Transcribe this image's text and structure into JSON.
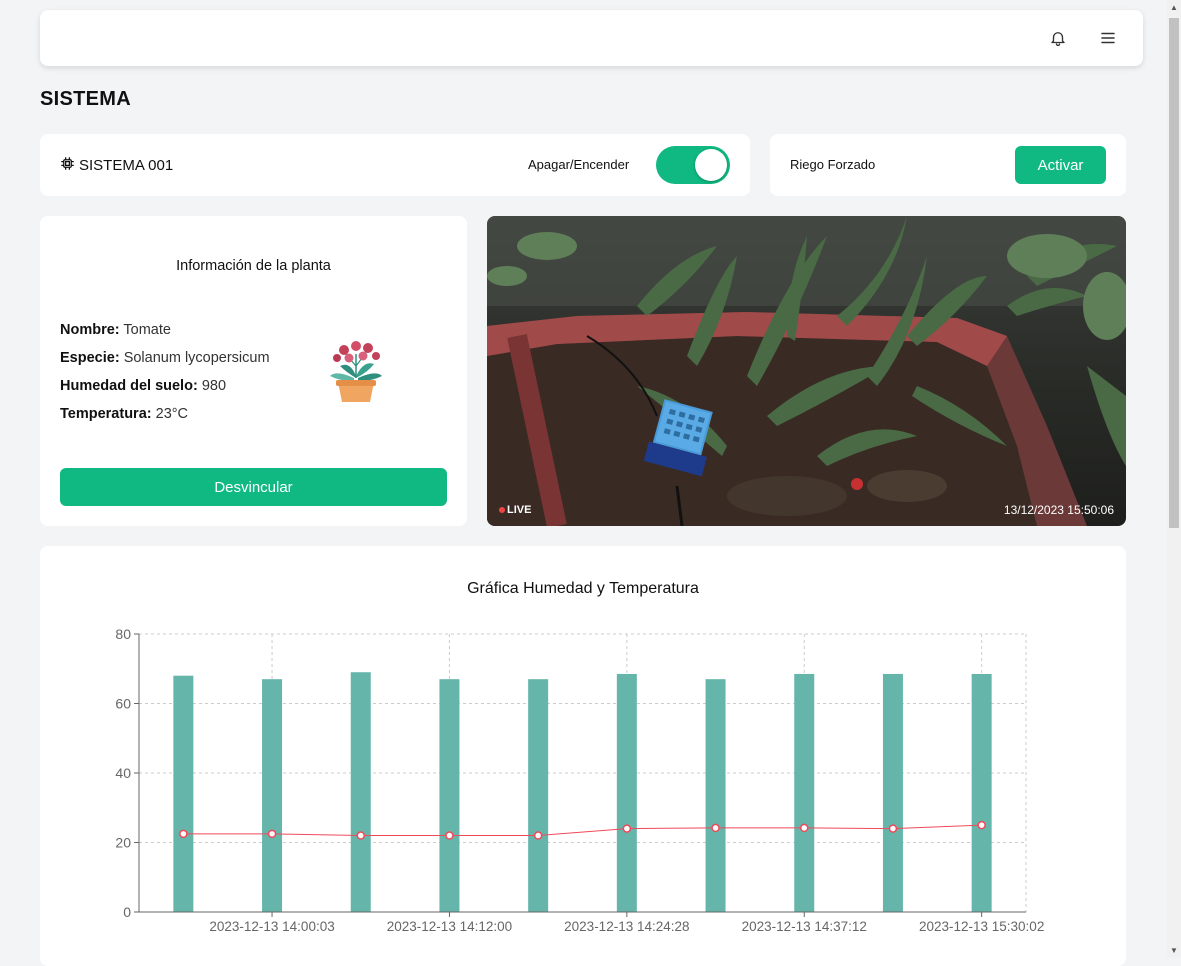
{
  "header": {
    "notification_icon": "bell-icon",
    "menu_icon": "hamburger-menu-icon"
  },
  "page_title": "SISTEMA",
  "system": {
    "icon": "chip-icon",
    "name": "SISTEMA 001",
    "toggle_label": "Apagar/Encender",
    "toggle_on": true
  },
  "riego": {
    "label": "Riego Forzado",
    "button_label": "Activar"
  },
  "plant_info": {
    "title": "Información de la planta",
    "fields": [
      {
        "label": "Nombre:",
        "value": "Tomate"
      },
      {
        "label": "Especie:",
        "value": "Solanum lycopersicum"
      },
      {
        "label": "Humedad del suelo:",
        "value": "980"
      },
      {
        "label": "Temperatura:",
        "value": "23°C"
      }
    ],
    "image_icon": "flower-pot-icon",
    "button_label": "Desvincular"
  },
  "video": {
    "live_label": "LIVE",
    "timestamp": "13/12/2023 15:50:06"
  },
  "colors": {
    "accent": "#10b981",
    "bar": "#66b5ab",
    "line": "#ef4a5a"
  },
  "chart_data": {
    "type": "bar",
    "title": "Gráfica Humedad y Temperatura",
    "xlabel": "",
    "ylabel": "",
    "ylim": [
      0,
      80
    ],
    "yticks": [
      0,
      20,
      40,
      60,
      80
    ],
    "grid": true,
    "x_tick_labels": [
      "2023-12-13 14:00:03",
      "2023-12-13 14:12:00",
      "2023-12-13 14:24:28",
      "2023-12-13 14:37:12",
      "2023-12-13 15:30:02"
    ],
    "series": [
      {
        "kind": "bar",
        "values": [
          68,
          67,
          69,
          67,
          67,
          68.5,
          67,
          68.5,
          68.5,
          68.5
        ]
      },
      {
        "kind": "line",
        "values": [
          22.5,
          22.5,
          22,
          22,
          22,
          24,
          24.2,
          24.2,
          24,
          25
        ]
      }
    ]
  }
}
